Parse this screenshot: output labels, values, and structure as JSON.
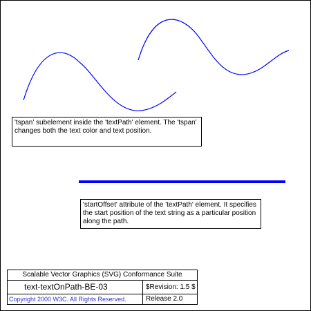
{
  "descriptions": {
    "tspan_note": "'tspan' subelement inside the 'textPath' element. The 'tspan' changes both the text color and text position.",
    "start_offset_note": "'startOffset' attribute of the 'textPath' element. It specifies the start position of the text string as a particular position along the path."
  },
  "legend": {
    "suite_title": "Scalable Vector Graphics (SVG) Conformance Suite",
    "test_name": "text-textOnPath-BE-03",
    "revision": "$Revision: 1.5 $",
    "copyright": "Copyright 2000 W3C. All Rights Reserved.",
    "release": "Release 2.0"
  },
  "colors": {
    "path_stroke": "#0000ff",
    "copyright_text": "#3333cc",
    "border": "#000000",
    "background": "#ffffff"
  }
}
